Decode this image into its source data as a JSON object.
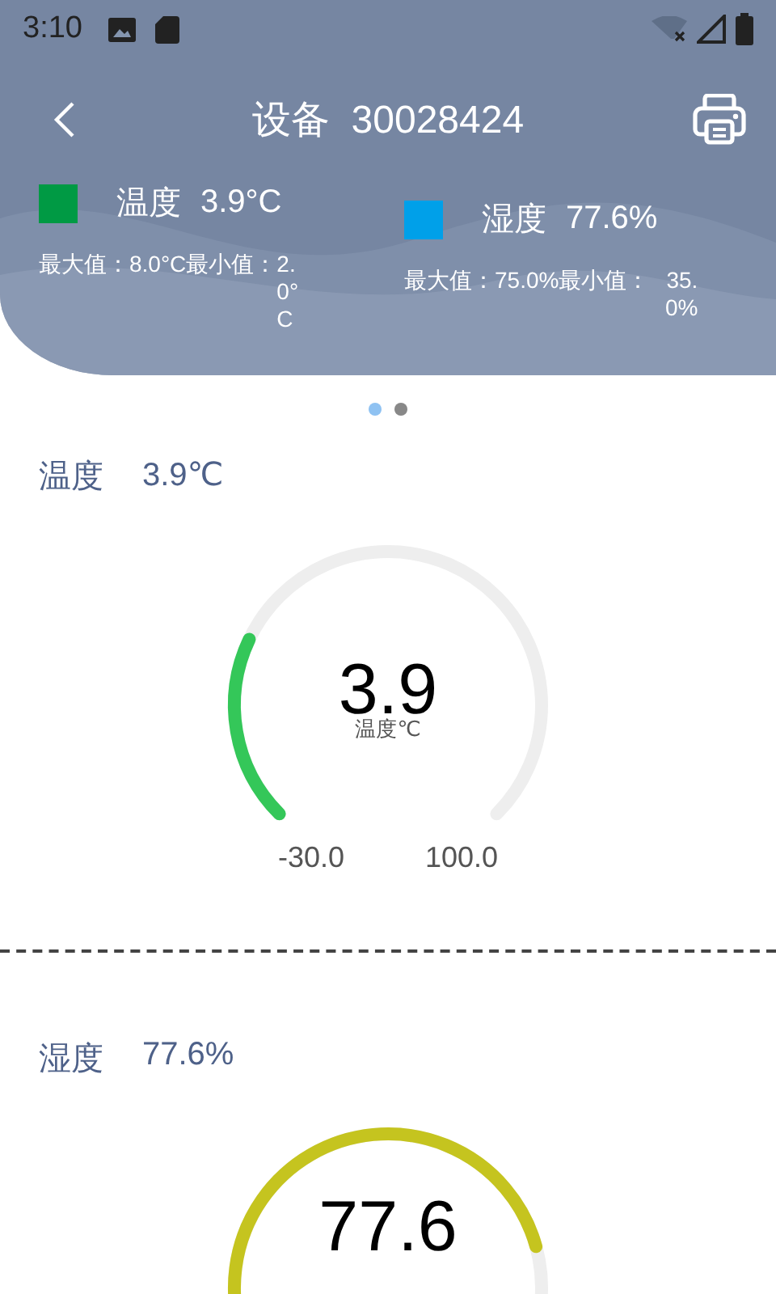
{
  "status_bar": {
    "time": "3:10"
  },
  "header": {
    "title": "设备  30028424"
  },
  "legend": [
    {
      "color": "#009a44",
      "name": "温度",
      "value": "3.9°C",
      "max_label": "最大值：",
      "max": "8.0°C",
      "min_label": "最小值：",
      "min": "2.0°C"
    },
    {
      "color": "#00a0e9",
      "name": "湿度",
      "value": "77.6%",
      "max_label": "最大值：",
      "max": "75.0%",
      "min_label": "最小值：",
      "min": "35.0%"
    }
  ],
  "pager": [
    {
      "selected": true
    },
    {
      "selected": false
    }
  ],
  "gauges": [
    {
      "name": "温度",
      "reading": "3.9℃",
      "value": "3.9",
      "unit": "温度℃",
      "min": "-30.0",
      "max": "100.0",
      "color": "#34c759"
    },
    {
      "name": "湿度",
      "reading": "77.6%",
      "value": "77.6",
      "color": "#c5c41f"
    }
  ]
}
